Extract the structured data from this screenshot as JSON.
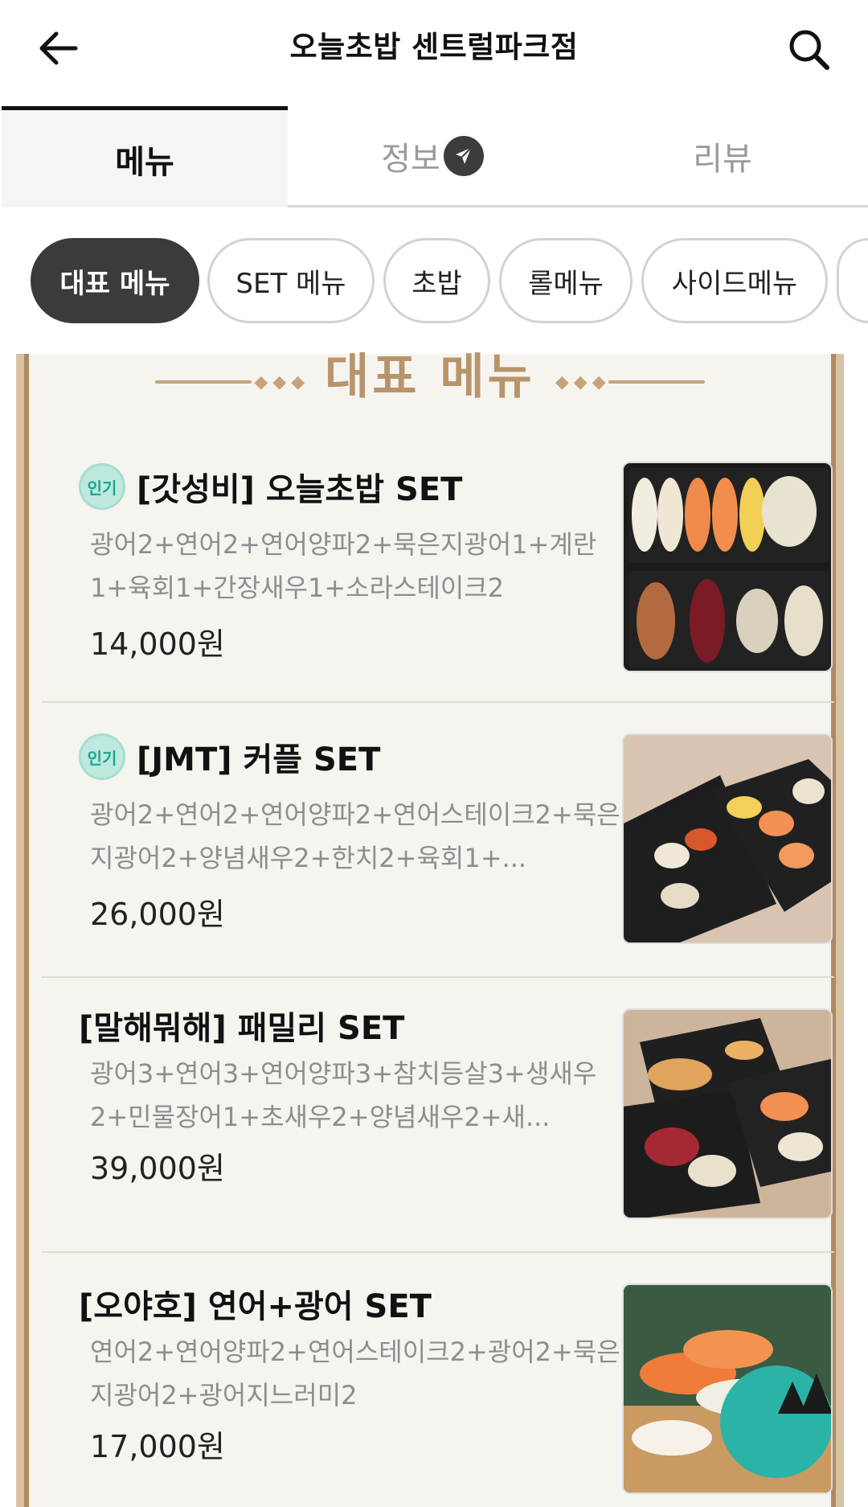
{
  "header": {
    "title": "오늘초밥 센트럴파크점",
    "back_icon": "arrow-left-icon",
    "search_icon": "search-icon"
  },
  "tabs": [
    {
      "label": "메뉴",
      "active": true
    },
    {
      "label": "정보",
      "badge_icon": "send-icon"
    },
    {
      "label": "리뷰"
    }
  ],
  "chips": [
    {
      "label": "대표 메뉴",
      "active": true
    },
    {
      "label": "SET 메뉴"
    },
    {
      "label": "초밥"
    },
    {
      "label": "롤메뉴"
    },
    {
      "label": "사이드메뉴"
    }
  ],
  "section": {
    "title": "대표 메뉴"
  },
  "items": [
    {
      "badge": "인기",
      "name": "[갓성비] 오늘초밥 SET",
      "description": "광어2+연어2+연어양파2+묵은지광어1+계란1+육회1+간장새우1+소라스테이크2",
      "price": "14,000원"
    },
    {
      "badge": "인기",
      "name": "[JMT] 커플 SET",
      "description": "광어2+연어2+연어양파2+연어스테이크2+묵은지광어2+양념새우2+한치2+육회1+...",
      "price": "26,000원"
    },
    {
      "name": "[말해뭐해] 패밀리 SET",
      "description": "광어3+연어3+연어양파3+참치등살3+생새우2+민물장어1+초새우2+양념새우2+새...",
      "price": "39,000원"
    },
    {
      "name": "[오야호] 연어+광어 SET",
      "description": "연어2+연어양파2+연어스테이크2+광어2+묵은지광어2+광어지느러미2",
      "price": "17,000원"
    }
  ],
  "colors": {
    "accent_dark": "#3b3b3b",
    "frame_gold": "#b08a5e",
    "badge_mint": "#1aa58b"
  }
}
